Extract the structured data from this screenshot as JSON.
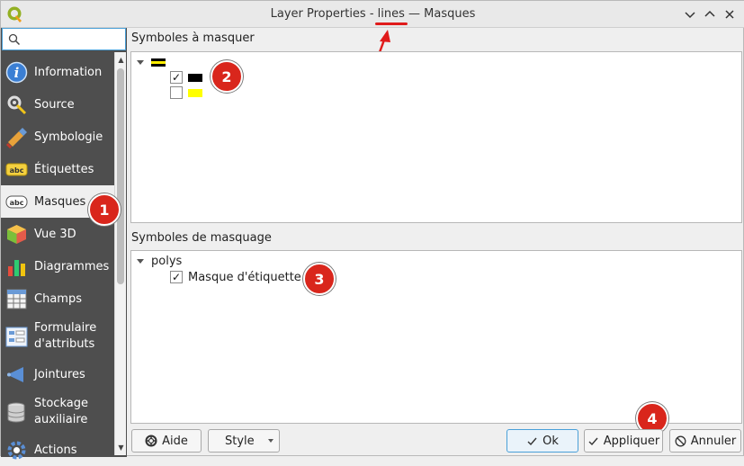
{
  "window": {
    "title_prefix": "Layer Properties - ",
    "title_layer": "lines",
    "title_suffix": " — Masques"
  },
  "search": {
    "placeholder": ""
  },
  "sidebar": {
    "items": [
      {
        "label": "Information",
        "icon": "info-icon"
      },
      {
        "label": "Source",
        "icon": "source-icon"
      },
      {
        "label": "Symbologie",
        "icon": "symbology-icon"
      },
      {
        "label": "Étiquettes",
        "icon": "labels-icon"
      },
      {
        "label": "Masques",
        "icon": "masks-icon",
        "selected": true
      },
      {
        "label": "Vue 3D",
        "icon": "cube-3d-icon"
      },
      {
        "label": "Diagrammes",
        "icon": "diagram-icon"
      },
      {
        "label": "Champs",
        "icon": "fields-icon"
      },
      {
        "label": "Formulaire d'attributs",
        "label_line1": "Formulaire",
        "label_line2": "d'attributs",
        "icon": "form-icon"
      },
      {
        "label": "Jointures",
        "icon": "joins-icon"
      },
      {
        "label": "Stockage auxiliaire",
        "label_line1": "Stockage",
        "label_line2": "auxiliaire",
        "icon": "storage-icon"
      },
      {
        "label": "Actions",
        "icon": "actions-icon"
      }
    ]
  },
  "masked_symbols": {
    "label": "Symboles à masquer",
    "root_swatch_colors": [
      "#ffee00",
      "#000000"
    ],
    "children": [
      {
        "checked": true,
        "check_mark": "✓",
        "color": "#000000"
      },
      {
        "checked": false,
        "check_mark": "",
        "color": "#ffff00"
      }
    ]
  },
  "masking_symbols": {
    "label": "Symboles de masquage",
    "root_label": "polys",
    "children": [
      {
        "label": "Masque d'étiquette",
        "checked": true,
        "check_mark": "✓"
      }
    ]
  },
  "callouts": [
    "1",
    "2",
    "3",
    "4"
  ],
  "accent_color": "#d9261c",
  "buttons": {
    "help": "Aide",
    "style": "Style",
    "ok": "Ok",
    "apply": "Appliquer",
    "cancel": "Annuler"
  }
}
